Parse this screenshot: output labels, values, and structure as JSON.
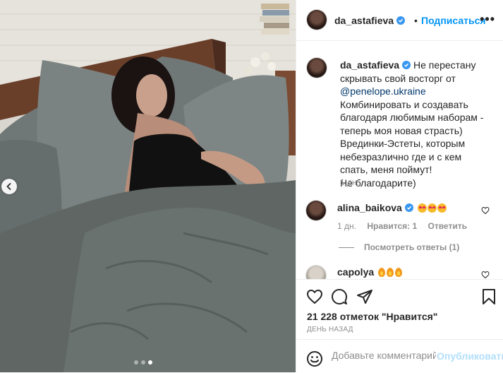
{
  "post": {
    "username": "da_astafieva",
    "follow_label": "Подписаться",
    "more_label": "•••",
    "separator": "•"
  },
  "caption": {
    "username": "da_astafieva",
    "lines": [
      "Не перестану скрывать свой восторг от",
      "@penelope.ukraine",
      "Комбинировать и создавать благодаря любимым наборам - теперь моя новая страсть)",
      "Врединки-Эстеты, которым небезразлично где и с кем спать, меня поймут!",
      "Не благодарите)"
    ],
    "time": "1 дн."
  },
  "comments": [
    {
      "username": "alina_baikova",
      "verified": true,
      "emoji": "heart-eyes x3",
      "time": "1 дн.",
      "likes": "Нравится: 1",
      "reply": "Ответить",
      "view_replies": "Посмотреть ответы (1)"
    },
    {
      "username": "capolya",
      "emoji": "fire x3"
    }
  ],
  "likes_text": "21 228 отметок \"Нравится\"",
  "timestamp": "ДЕНЬ НАЗАД",
  "comment_box": {
    "placeholder": "Добавьте комментарий...",
    "post_label": "Опубликовать"
  },
  "carousel": {
    "count": 3,
    "active": 3
  },
  "colors": {
    "accent": "#0095f6",
    "verified": "#3897f0",
    "muted": "#8e8e8e",
    "sheet": "#5f6664"
  }
}
